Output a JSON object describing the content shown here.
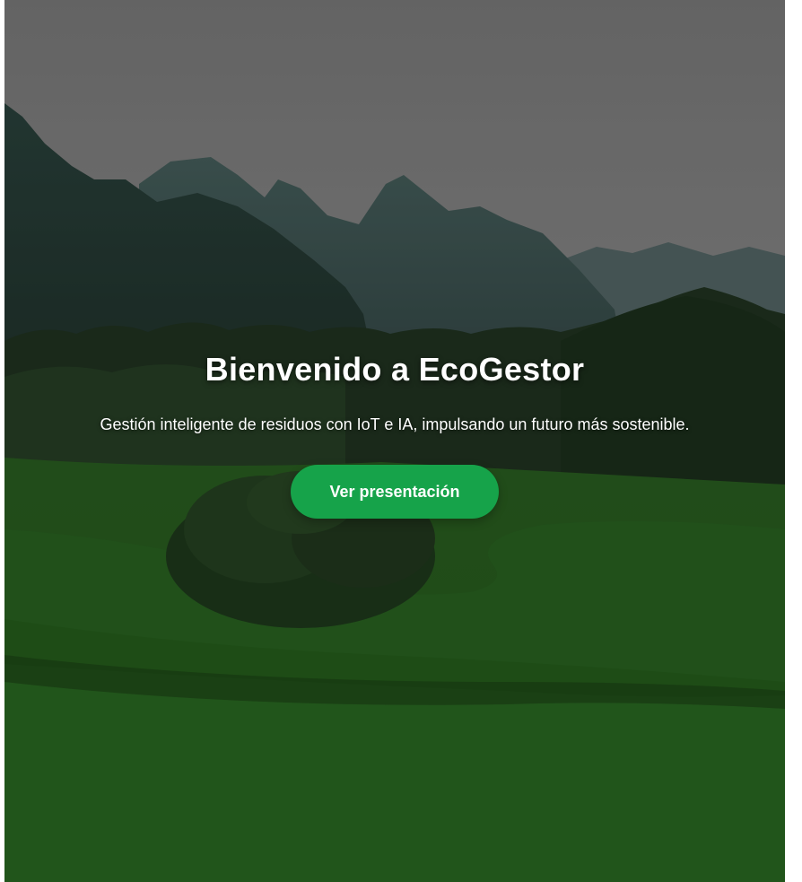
{
  "hero": {
    "title": "Bienvenido a EcoGestor",
    "subtitle": "Gestión inteligente de residuos con IoT e IA, impulsando un futuro más sostenible.",
    "cta_label": "Ver presentación",
    "background_image": "landscape-mountains-rice-fields",
    "colors": {
      "cta_background": "#16a34a",
      "text": "#ffffff"
    }
  }
}
